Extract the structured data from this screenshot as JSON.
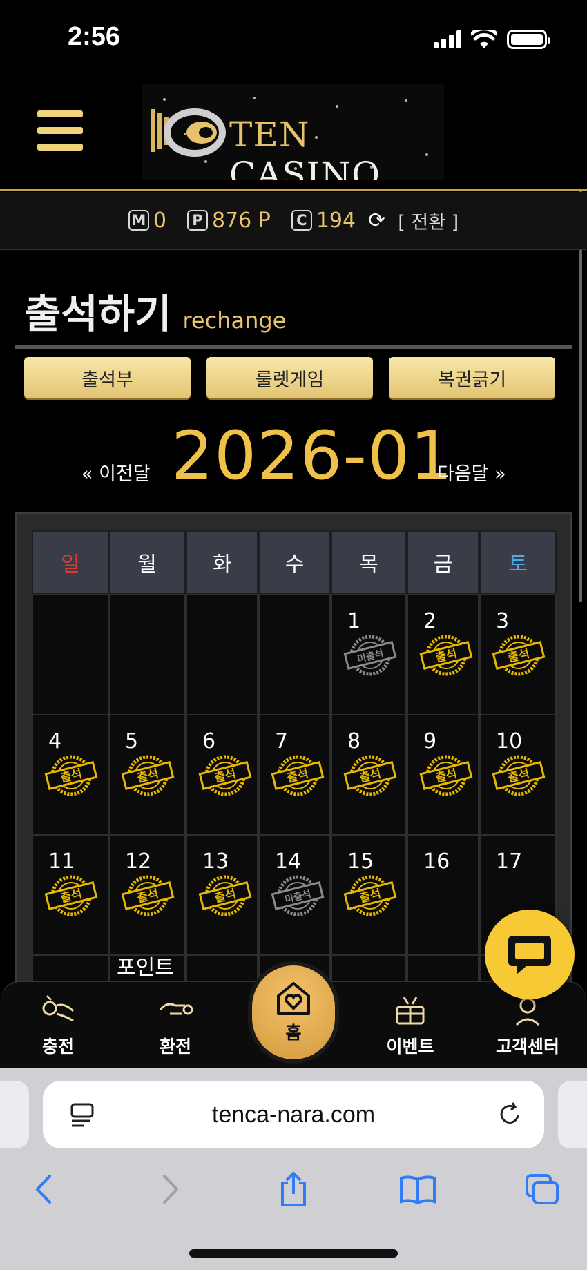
{
  "status_bar": {
    "time": "2:56"
  },
  "header": {
    "logo_ten": "TEN",
    "logo_casino": "CASINO"
  },
  "points": {
    "m_icon": "M",
    "m_value": "0",
    "p_icon": "P",
    "p_value": "876 P",
    "c_icon": "C",
    "c_value": "194",
    "refresh_glyph": "⟳",
    "convert_label": "[ 전환 ]"
  },
  "page": {
    "title": "출석하기",
    "subtitle": "rechange"
  },
  "tabs": [
    {
      "label": "출석부"
    },
    {
      "label": "룰렛게임"
    },
    {
      "label": "복권긁기"
    }
  ],
  "month_nav": {
    "prev": "« 이전달",
    "current": "2026-01",
    "next": "다음달 »"
  },
  "calendar": {
    "weekdays": [
      "일",
      "월",
      "화",
      "수",
      "목",
      "금",
      "토"
    ],
    "weekday_colors": [
      "#e03a3a",
      "#ffffff",
      "#ffffff",
      "#ffffff",
      "#ffffff",
      "#ffffff",
      "#4fa8e0"
    ],
    "rows": [
      [
        null,
        null,
        null,
        null,
        {
          "d": "1",
          "s": "absent"
        },
        {
          "d": "2",
          "s": "present"
        },
        {
          "d": "3",
          "s": "present"
        }
      ],
      [
        {
          "d": "4",
          "s": "present"
        },
        {
          "d": "5",
          "s": "present"
        },
        {
          "d": "6",
          "s": "present"
        },
        {
          "d": "7",
          "s": "present"
        },
        {
          "d": "8",
          "s": "present"
        },
        {
          "d": "9",
          "s": "present"
        },
        {
          "d": "10",
          "s": "present"
        }
      ],
      [
        {
          "d": "11",
          "s": "present"
        },
        {
          "d": "12",
          "s": "present"
        },
        {
          "d": "13",
          "s": "present"
        },
        {
          "d": "14",
          "s": "absent"
        },
        {
          "d": "15",
          "s": "present"
        },
        {
          "d": "16",
          "s": ""
        },
        {
          "d": "17",
          "s": ""
        }
      ]
    ],
    "stamp_present": "출석",
    "stamp_absent": "미출석",
    "partial_row_note": "포인트"
  },
  "bottom_nav": {
    "charge": "충전",
    "withdraw": "환전",
    "home": "홈",
    "event": "이벤트",
    "support": "고객센터"
  },
  "browser": {
    "url": "tenca-nara.com"
  },
  "colors": {
    "gold": "#e8c46c",
    "accent_yellow": "#f7c935",
    "sunday": "#e03a3a",
    "saturday": "#4fa8e0"
  }
}
